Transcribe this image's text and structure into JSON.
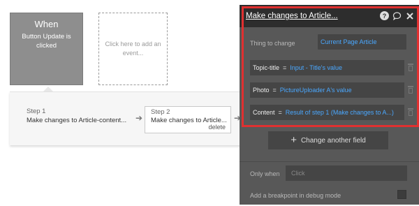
{
  "event": {
    "heading": "When",
    "description": "Button Update is clicked"
  },
  "add_event": {
    "label": "Click here to add an event..."
  },
  "steps": [
    {
      "label": "Step 1",
      "action": "Make changes to Article-content..."
    },
    {
      "label": "Step 2",
      "action": "Make changes to Article...",
      "delete_label": "delete"
    }
  ],
  "panel": {
    "title": "Make changes to Article...",
    "icons": [
      "help-icon",
      "comment-icon",
      "close-icon"
    ],
    "thing_to_change_label": "Thing to change",
    "thing_to_change_value": "Current Page Article",
    "fields": [
      {
        "name": "Topic-title",
        "op": "=",
        "value": "Input - Title's value"
      },
      {
        "name": "Photo",
        "op": "=",
        "value": "PictureUploader A's value"
      },
      {
        "name": "Content",
        "op": "=",
        "value": "Result of step 1 (Make changes to A...)"
      }
    ],
    "change_another_field": "Change another field",
    "only_when_label": "Only when",
    "only_when_placeholder": "Click",
    "breakpoint_label": "Add a breakpoint in debug mode",
    "breakpoint_checked": false
  },
  "colors": {
    "highlight": "#e03030",
    "link_blue": "#4aa8ff",
    "panel_bg": "#585858"
  }
}
